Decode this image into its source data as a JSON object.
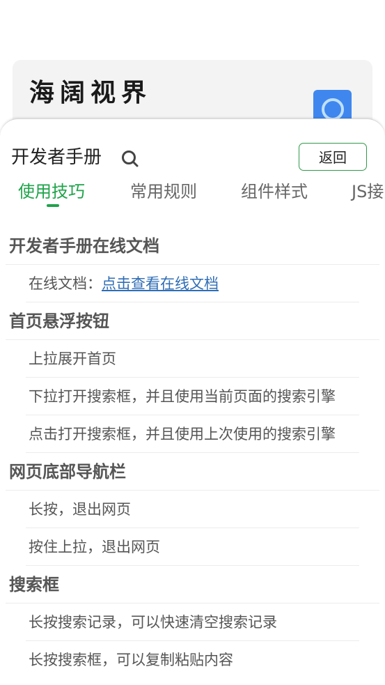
{
  "background": {
    "title": "海阔视界"
  },
  "sheet": {
    "title": "开发者手册",
    "back_label": "返回"
  },
  "tabs": [
    {
      "label": "使用技巧",
      "active": true
    },
    {
      "label": "常用规则",
      "active": false
    },
    {
      "label": "组件样式",
      "active": false
    },
    {
      "label": "JS接",
      "active": false
    }
  ],
  "sections": [
    {
      "title": "开发者手册在线文档",
      "items": [
        {
          "prefix": "在线文档：",
          "link": "点击查看在线文档"
        }
      ]
    },
    {
      "title": "首页悬浮按钮",
      "items": [
        {
          "text": "上拉展开首页"
        },
        {
          "text": "下拉打开搜索框，并且使用当前页面的搜索引擎"
        },
        {
          "text": "点击打开搜索框，并且使用上次使用的搜索引擎"
        }
      ]
    },
    {
      "title": "网页底部导航栏",
      "items": [
        {
          "text": "长按，退出网页"
        },
        {
          "text": "按住上拉，退出网页"
        }
      ]
    },
    {
      "title": "搜索框",
      "items": [
        {
          "text": "长按搜索记录，可以快速清空搜索记录"
        },
        {
          "text": "长按搜索框，可以复制粘贴内容"
        }
      ]
    }
  ],
  "colors": {
    "accent": "#1ea44a",
    "link": "#2f6db5",
    "search_button": "#3f87ee"
  },
  "icons": {
    "search": "search-icon",
    "bg_search": "search-icon"
  }
}
